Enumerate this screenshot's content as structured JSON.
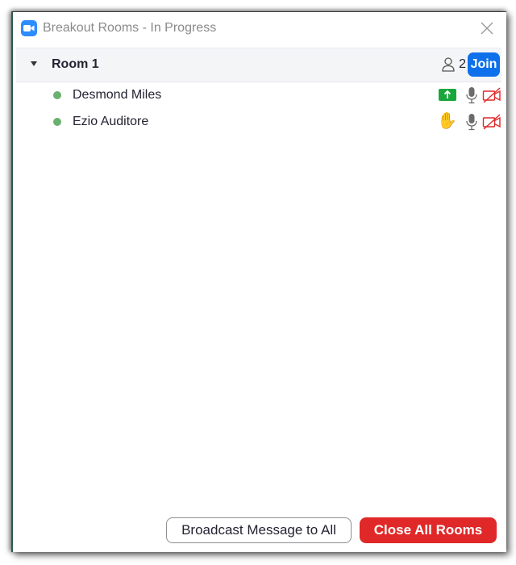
{
  "window": {
    "title": "Breakout Rooms - In Progress",
    "app_icon": "zoom-camera-icon",
    "close_icon": "close-x-icon"
  },
  "rooms": [
    {
      "name": "Room 1",
      "expanded": true,
      "participant_count": "2",
      "join_label": "Join",
      "participants": [
        {
          "name": "Desmond Miles",
          "status_color": "#6ab06f",
          "status_icon": "share-screen-icon",
          "mic": "mic-unmuted-icon",
          "video": "video-off-icon"
        },
        {
          "name": "Ezio Auditore",
          "status_color": "#6ab06f",
          "status_icon": "raised-hand-icon",
          "status_glyph": "✋",
          "mic": "mic-unmuted-icon",
          "video": "video-off-icon"
        }
      ]
    }
  ],
  "footer": {
    "broadcast_label": "Broadcast Message to All",
    "close_all_label": "Close All Rooms"
  },
  "colors": {
    "join_blue": "#0e71eb",
    "close_red": "#e02828",
    "online_green": "#6ab06f",
    "share_green": "#1aa63a",
    "video_off_red": "#e02828"
  }
}
